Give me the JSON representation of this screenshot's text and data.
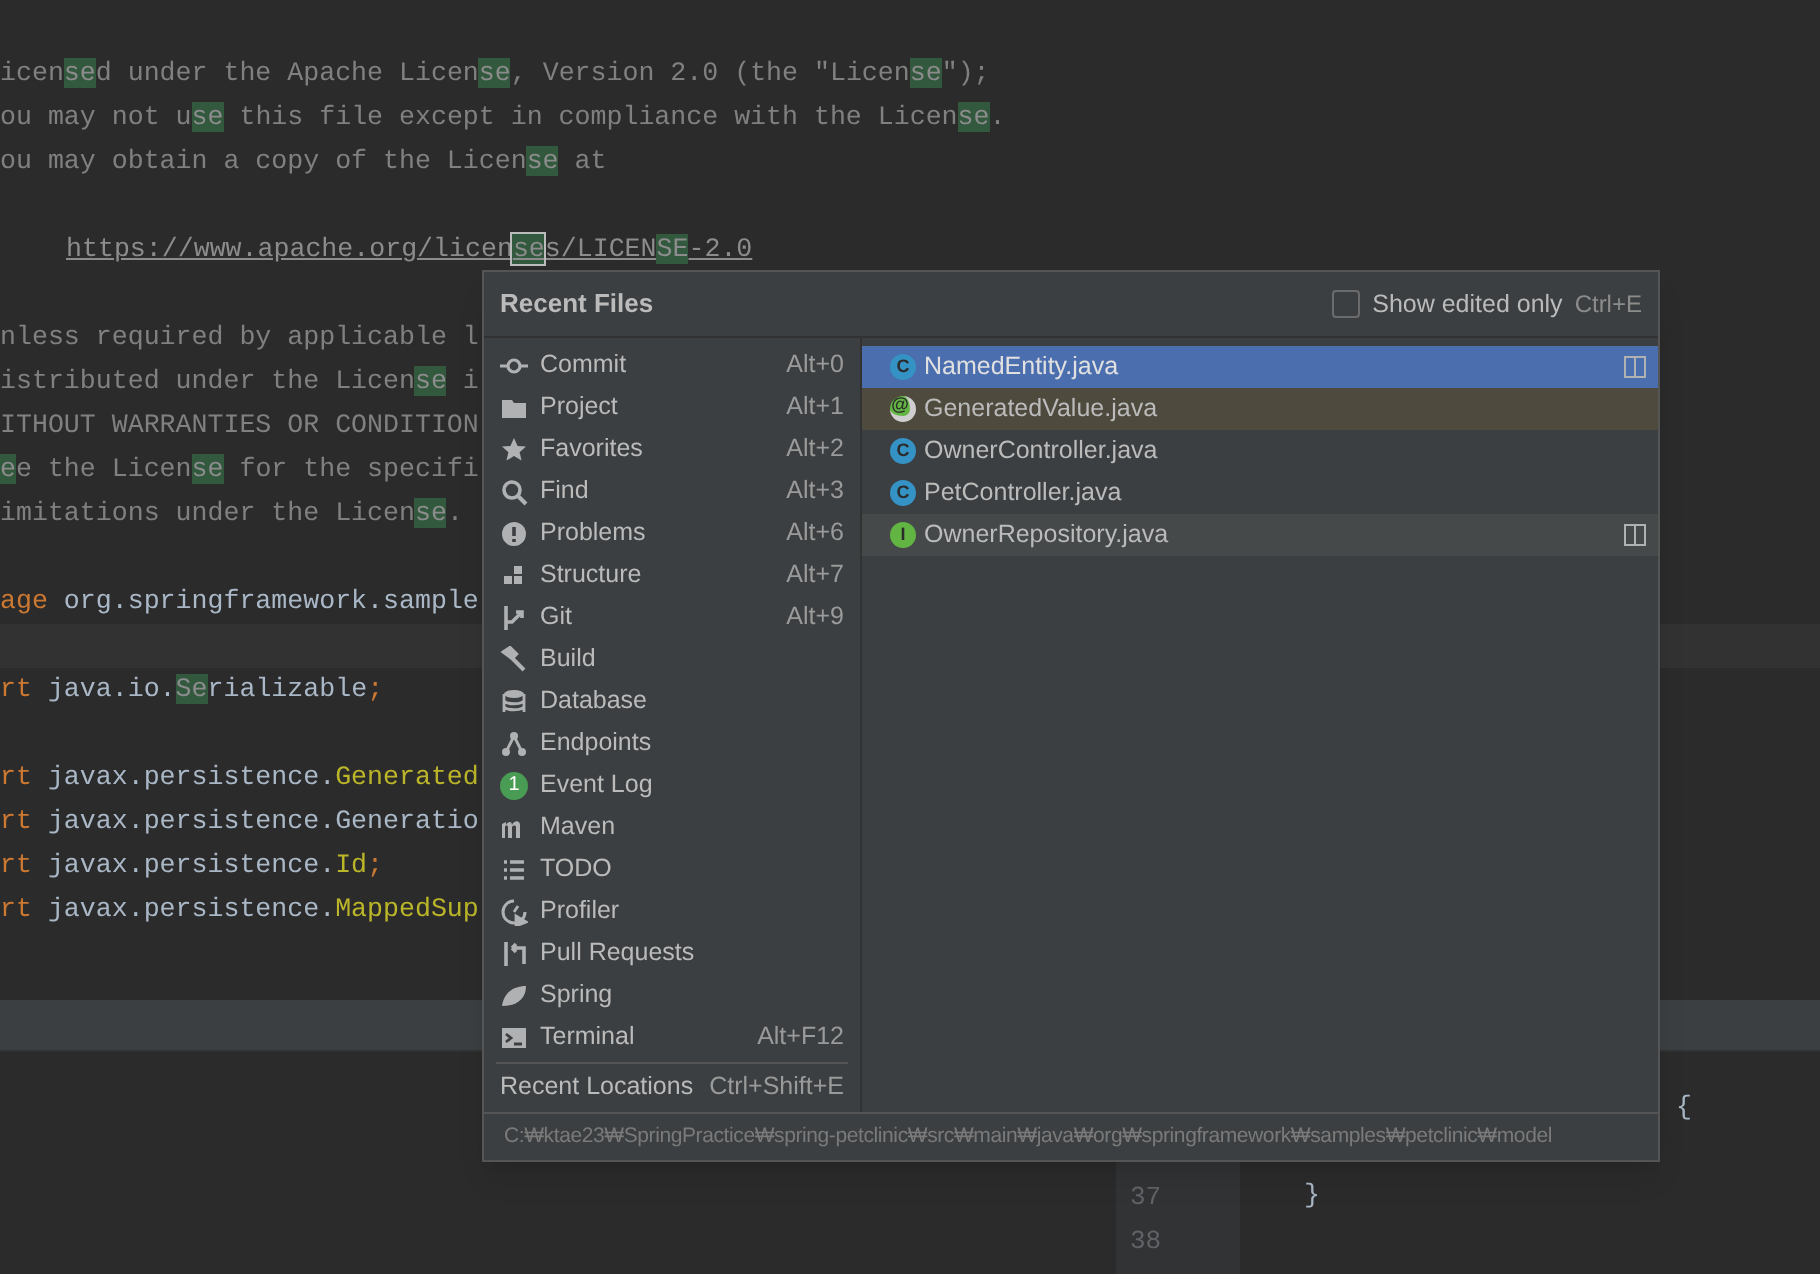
{
  "editor": {
    "lines": [
      {
        "segments": [
          {
            "text": "icen",
            "kind": "comment"
          },
          {
            "text": "se",
            "kind": "match"
          },
          {
            "text": "d under the Apache Licen",
            "kind": "comment"
          },
          {
            "text": "se",
            "kind": "match"
          },
          {
            "text": ", Version 2.0 (the \"Licen",
            "kind": "comment"
          },
          {
            "text": "se",
            "kind": "match"
          },
          {
            "text": "\");",
            "kind": "comment"
          }
        ]
      },
      {
        "segments": [
          {
            "text": "ou may not u",
            "kind": "comment"
          },
          {
            "text": "se",
            "kind": "match"
          },
          {
            "text": " this file except in compliance with the Licen",
            "kind": "comment"
          },
          {
            "text": "se",
            "kind": "match"
          },
          {
            "text": ".",
            "kind": "comment"
          }
        ]
      },
      {
        "segments": [
          {
            "text": "ou may obtain a copy of the Licen",
            "kind": "comment"
          },
          {
            "text": "se",
            "kind": "match"
          },
          {
            "text": " at",
            "kind": "comment"
          }
        ]
      },
      {
        "blank_line_before": true,
        "indented": true,
        "segments": [
          {
            "text": "https://www.apache.org/licen",
            "kind": "link"
          },
          {
            "text": "se",
            "kind": "current"
          },
          {
            "text": "s/LICEN",
            "kind": "link"
          },
          {
            "text": "SE",
            "kind": "match"
          },
          {
            "text": "-2.0",
            "kind": "link"
          }
        ]
      },
      {
        "blank_line_before": true,
        "segments": [
          {
            "text": "nless required by applicable l",
            "kind": "comment"
          }
        ]
      },
      {
        "segments": [
          {
            "text": "istributed under the Licen",
            "kind": "comment"
          },
          {
            "text": "se",
            "kind": "match"
          },
          {
            "text": " i",
            "kind": "comment"
          }
        ]
      },
      {
        "segments": [
          {
            "text": "ITHOUT WARRANTIES OR CONDITION",
            "kind": "comment"
          }
        ]
      },
      {
        "segments": [
          {
            "text": "e",
            "kind": "match"
          },
          {
            "text": "e the Licen",
            "kind": "comment"
          },
          {
            "text": "se",
            "kind": "match"
          },
          {
            "text": " for the specifi",
            "kind": "comment"
          }
        ]
      },
      {
        "segments": [
          {
            "text": "imitations under the Licen",
            "kind": "comment"
          },
          {
            "text": "se",
            "kind": "match"
          },
          {
            "text": ".",
            "kind": "comment"
          }
        ]
      },
      {
        "blank_line_before": true,
        "segments": [
          {
            "text": "age",
            "kind": "keyword"
          },
          {
            "text": " org.springframework.sample",
            "kind": "code"
          }
        ]
      },
      {
        "caret_line_before": true,
        "segments": [
          {
            "text": "rt",
            "kind": "keyword"
          },
          {
            "text": " java.io.",
            "kind": "code"
          },
          {
            "text": "Se",
            "kind": "match"
          },
          {
            "text": "rializable",
            "kind": "code"
          },
          {
            "text": ";",
            "kind": "keyword"
          }
        ]
      },
      {
        "blank_line_before": true,
        "segments": [
          {
            "text": "rt",
            "kind": "keyword"
          },
          {
            "text": " javax.persistence.",
            "kind": "code"
          },
          {
            "text": "Generated",
            "kind": "annotation"
          }
        ]
      },
      {
        "segments": [
          {
            "text": "rt",
            "kind": "keyword"
          },
          {
            "text": " javax.persistence.Generatio",
            "kind": "code"
          }
        ]
      },
      {
        "segments": [
          {
            "text": "rt",
            "kind": "keyword"
          },
          {
            "text": " javax.persistence.",
            "kind": "code"
          },
          {
            "text": "Id",
            "kind": "annotation"
          },
          {
            "text": ";",
            "kind": "keyword"
          }
        ]
      },
      {
        "segments": [
          {
            "text": "rt",
            "kind": "keyword"
          },
          {
            "text": " javax.persistence.",
            "kind": "code"
          },
          {
            "text": "MappedSup",
            "kind": "annotation"
          }
        ]
      }
    ]
  },
  "second_editor": {
    "line_numbers": [
      "37",
      "38"
    ],
    "open_brace": "{",
    "close_brace": "}"
  },
  "popup": {
    "title": "Recent Files",
    "show_edited_only": {
      "label": "Show edited only",
      "shortcut": "Ctrl+E",
      "checked": false
    },
    "tool_windows": [
      {
        "label": "Commit",
        "shortcut": "Alt+0"
      },
      {
        "label": "Project",
        "shortcut": "Alt+1"
      },
      {
        "label": "Favorites",
        "shortcut": "Alt+2"
      },
      {
        "label": "Find",
        "shortcut": "Alt+3"
      },
      {
        "label": "Problems",
        "shortcut": "Alt+6"
      },
      {
        "label": "Structure",
        "shortcut": "Alt+7"
      },
      {
        "label": "Git",
        "shortcut": "Alt+9"
      },
      {
        "label": "Build"
      },
      {
        "label": "Database"
      },
      {
        "label": "Endpoints"
      },
      {
        "label": "Event Log",
        "badge": "1"
      },
      {
        "label": "Maven"
      },
      {
        "label": "TODO"
      },
      {
        "label": "Profiler"
      },
      {
        "label": "Pull Requests"
      },
      {
        "label": "Spring"
      },
      {
        "label": "Terminal",
        "shortcut": "Alt+F12"
      }
    ],
    "recent_locations": {
      "label": "Recent Locations",
      "shortcut": "Ctrl+Shift+E"
    },
    "files": [
      {
        "name": "NamedEntity.java",
        "kind": "class",
        "icon_letter": "C",
        "selected": true,
        "split": true
      },
      {
        "name": "GeneratedValue.java",
        "kind": "annotation",
        "icon_letter": "@",
        "selected": false,
        "locked": true,
        "color": "#4e4a3e"
      },
      {
        "name": "OwnerController.java",
        "kind": "class",
        "icon_letter": "C",
        "selected": false
      },
      {
        "name": "PetController.java",
        "kind": "class",
        "icon_letter": "C",
        "selected": false
      },
      {
        "name": "OwnerRepository.java",
        "kind": "interface",
        "icon_letter": "I",
        "selected": false,
        "split": true,
        "hovered": true
      }
    ],
    "path": "C:₩ktae23₩SpringPractice₩spring-petclinic₩src₩main₩java₩org₩springframework₩samples₩petclinic₩model"
  }
}
